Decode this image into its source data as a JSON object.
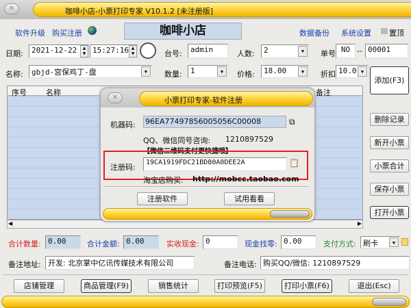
{
  "window": {
    "title": "咖啡小店-小票打印专家 V10.1.2 [未注册版]"
  },
  "top": {
    "upgrade": "软件升级",
    "buy": "购买注册",
    "store_name": "咖啡小店",
    "backup": "数据备份",
    "settings": "系统设置",
    "pin": "置顶"
  },
  "form": {
    "date_label": "日期:",
    "date": "2021-12-22",
    "time": "15:27:16",
    "table_label": "台号:",
    "table": "admin",
    "people_label": "人数:",
    "people": "2",
    "order_label": "单号:",
    "order_prefix": "NO",
    "order_dash": "--",
    "order_no": "00001",
    "name_label": "名称:",
    "name": "gbjd-宫保鸡丁-盘",
    "qty_label": "数量:",
    "qty": "1",
    "price_label": "价格:",
    "price": "18.00",
    "discount_label": "折扣:",
    "discount": "10.0",
    "add": "添加(F3)"
  },
  "table": {
    "columns": [
      "序号",
      "名称",
      "备注"
    ]
  },
  "side_buttons": [
    "删除记录",
    "新开小票",
    "小票合计",
    "保存小票",
    "打开小票"
  ],
  "totals": {
    "qty_label": "合计数量:",
    "qty": "0.00",
    "amount_label": "合计金额:",
    "amount": "0.00",
    "cash_label": "实收现金:",
    "cash": "0",
    "change_label": "现金找零:",
    "change": "0.00",
    "pay_label": "支付方式:",
    "pay": "刷卡"
  },
  "remarks": {
    "addr_label": "备注地址:",
    "addr": "开发: 北京掌中亿讯传媒技术有限公司",
    "phone_label": "备注电话:",
    "phone": "购买QQ/微信: 1210897529"
  },
  "bottom_buttons": [
    "店铺管理",
    "商品管理(F9)",
    "销售统计",
    "打印预览(F5)",
    "打印小票(F6)",
    "退出(Esc)"
  ],
  "dialog": {
    "title": "小票打印专家-软件注册",
    "machine_label": "机器码:",
    "machine_code": "96EA77497856005056C00008",
    "qq_label": "QQ、微信同号咨询:",
    "qq": "1210897529",
    "wechat_note": "【微信二维码支付更快捷哦】",
    "reg_label": "注册码:",
    "reg_code": "19CA1919FDC21BD80A0DEE2A",
    "shop_label": "淘宝店购买:",
    "shop_url": "http://mobcc.taobao.com",
    "register": "注册软件",
    "trial": "试用看看"
  },
  "colors": {
    "gold": "#ffd43a",
    "red_box": "#e02020",
    "qty_label": "#d02020",
    "amount_label": "#1a3fa8",
    "pay_label": "#2a8a2a"
  }
}
